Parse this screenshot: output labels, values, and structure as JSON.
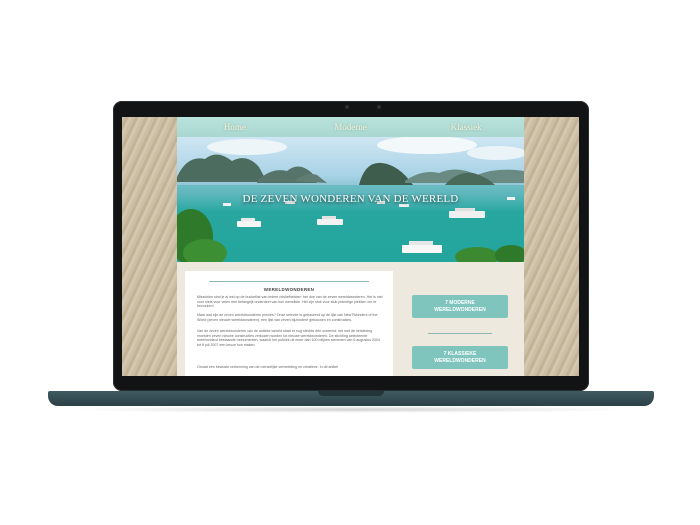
{
  "nav": {
    "items": [
      "Home",
      "Moderne",
      "Klassiek"
    ]
  },
  "hero": {
    "title": "DE ZEVEN WONDEREN VAN DE WERELD"
  },
  "content": {
    "heading": "WERELDWONDEREN",
    "paragraphs": [
      "Misschien sind je al wel op de bucketlist van iedere reisliefhebber: het doe van de zeven wereldwonderen. Het is niet voor niets voor velen een belangrijk onderdeel van hun wensliste. Het zijn stuk voor stuk prachtige plekken om te bezoeken!",
      "Maar wat zijn de zeven wereldwonderen precies? Onze selectie is gebaseerd op de lijst van New7Wonders of the World (zeven nieuwe wereldwonderen), een lijst van zeven bijzondere gebouwen en constructies.",
      "Van de zeven wereldwonderen van de antieke wereld staat er nog slechts één overeind: het met de verkiezing moesten zeven nieuwe constructies verkozen worden tot nieuwe wereldwonderen. De stichting selecteerde tweehonderd bestaande monumenten, waaruit het publiek uit meer dan 100 miljoen stemmen van 6 augustus 2004 tot 6 juli 2007 een keuze kon maken.",
      "Omdat een bewuste verkenning van de menselijke verbeelding en creatieve. In dit artikel"
    ]
  },
  "sidebar": {
    "modern_button": "7 MODERNE\nWERELDWONDEREN",
    "classic_button": "7 KLASSIEKE\nWERELDWONDEREN"
  },
  "colors": {
    "nav": "#a9d8d0",
    "button": "#7fc5bd",
    "laptop_base": "#35505a",
    "sand": "#c9b9a0"
  }
}
